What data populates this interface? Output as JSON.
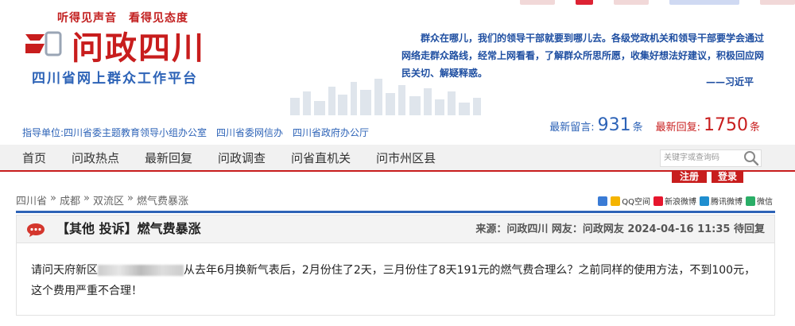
{
  "header": {
    "slogan": "听得见声音　看得见态度",
    "title": "问政四川",
    "subtitle": "四川省网上群众工作平台",
    "quote": "群众在哪儿，我们的领导干部就要到哪儿去。各级党政机关和领导干部要学会通过网络走群众路线，经常上网看看，了解群众所思所愿，收集好想法好建议，积极回应网民关切、解疑释惑。",
    "quote_author": "——习近平",
    "sponsor": "指导单位:四川省委主题教育领导小组办公室　四川省委网信办　四川省政府办公厅",
    "stats": {
      "latest_message_label": "最新留言:",
      "latest_message_count": "931",
      "latest_message_unit": "条",
      "latest_reply_label": "最新回复:",
      "latest_reply_count": "1750",
      "latest_reply_unit": "条"
    }
  },
  "nav": {
    "items": [
      "首页",
      "问政热点",
      "最新回复",
      "问政调查",
      "问省直机关",
      "问市州区县"
    ],
    "search_placeholder": "关键字或查询码",
    "register": "注册",
    "login": "登录"
  },
  "breadcrumb": {
    "items": [
      "四川省",
      "»",
      "成都",
      "»",
      "双流区",
      "»",
      "燃气费暴涨"
    ]
  },
  "shares": [
    "QQ空间",
    "新浪微博",
    "腾讯微博",
    "微信"
  ],
  "post": {
    "title": "【其他 投诉】燃气费暴涨",
    "meta": "来源：问政四川 网友：问政网友 2024-04-16 11:35 待回复",
    "body_prefix": "请问天府新区",
    "body_suffix": "从去年6月换新气表后，2月份住了2天，三月份住了8天191元的燃气费合理么？之前同样的使用方法，不到100元，这个费用严重不合理！"
  },
  "colors": {
    "brand_red": "#c81d1d",
    "brand_blue": "#2d63b7"
  }
}
